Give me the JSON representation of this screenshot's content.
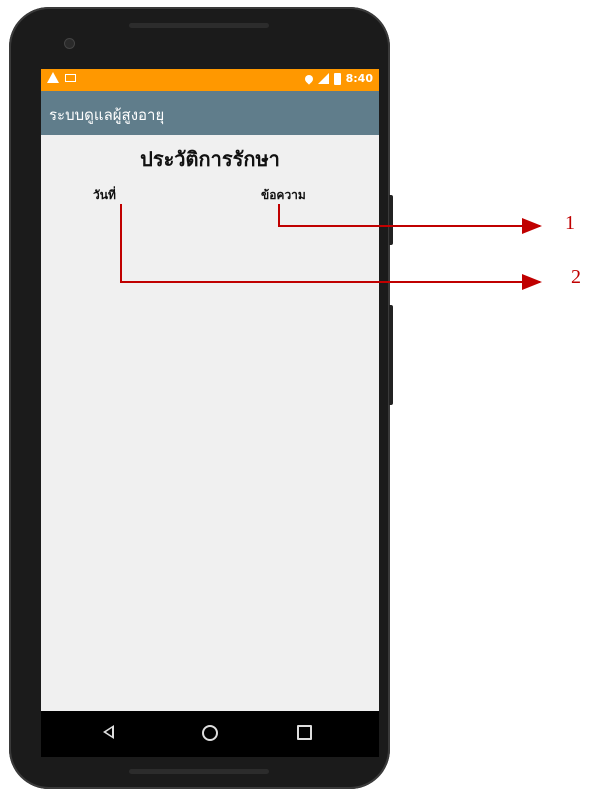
{
  "status_bar": {
    "time": "8:40",
    "icons": [
      "warning-icon",
      "mail-icon",
      "location-icon",
      "signal-icon",
      "battery-icon"
    ]
  },
  "app_bar": {
    "title": "ระบบดูแลผู้สูงอายุ"
  },
  "page": {
    "title": "ประวัติการรักษา",
    "columns": [
      "วันที่",
      "ข้อความ"
    ]
  },
  "nav_bar": {
    "icons": [
      "back-icon",
      "home-icon",
      "recent-apps-icon"
    ]
  },
  "annotations": [
    {
      "label": "1",
      "target": "ข้อความ"
    },
    {
      "label": "2",
      "target": "วันที่"
    }
  ],
  "colors": {
    "status_bar": "#ff9800",
    "app_bar": "#607d8b",
    "annotation": "#c00000"
  }
}
